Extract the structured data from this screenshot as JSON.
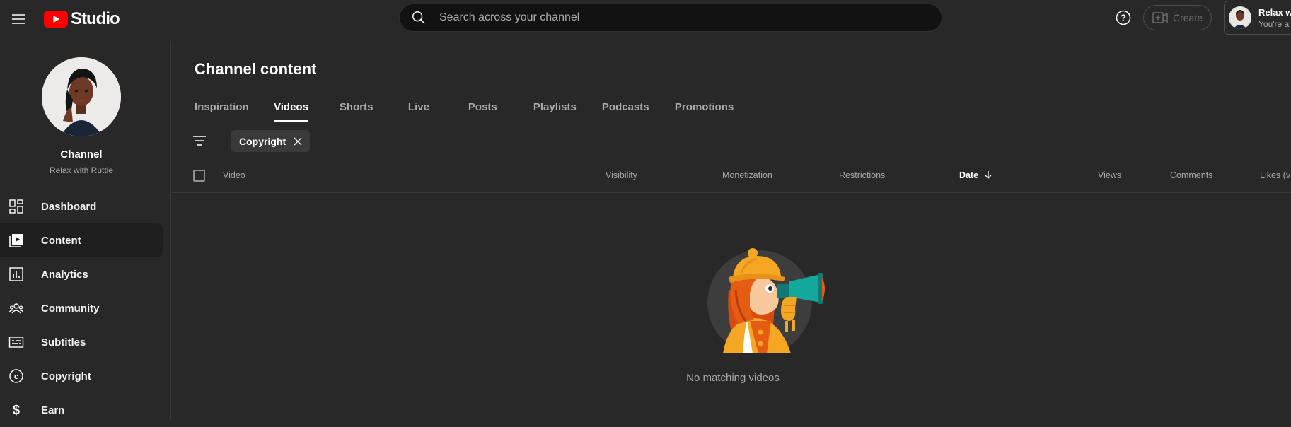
{
  "topbar": {
    "logo_text": "Studio",
    "search": {
      "placeholder": "Search across your channel",
      "value": ""
    },
    "create_label": "Create",
    "account": {
      "name": "Relax with Ruttie",
      "subtitle": "You're a"
    }
  },
  "sidebar": {
    "channel_label": "Channel",
    "channel_name": "Relax with Ruttie",
    "items": [
      {
        "label": "Dashboard",
        "icon": "dashboard-icon",
        "active": false
      },
      {
        "label": "Content",
        "icon": "content-icon",
        "active": true
      },
      {
        "label": "Analytics",
        "icon": "analytics-icon",
        "active": false
      },
      {
        "label": "Community",
        "icon": "community-icon",
        "active": false
      },
      {
        "label": "Subtitles",
        "icon": "subtitles-icon",
        "active": false
      },
      {
        "label": "Copyright",
        "icon": "copyright-icon",
        "active": false
      },
      {
        "label": "Earn",
        "icon": "earn-icon",
        "active": false
      }
    ]
  },
  "main": {
    "title": "Channel content",
    "tabs": [
      {
        "label": "Inspiration",
        "active": false
      },
      {
        "label": "Videos",
        "active": true
      },
      {
        "label": "Shorts",
        "active": false
      },
      {
        "label": "Live",
        "active": false
      },
      {
        "label": "Posts",
        "active": false
      },
      {
        "label": "Playlists",
        "active": false
      },
      {
        "label": "Podcasts",
        "active": false
      },
      {
        "label": "Promotions",
        "active": false
      }
    ],
    "filter_chip": "Copyright",
    "columns": {
      "video": "Video",
      "visibility": "Visibility",
      "monetization": "Monetization",
      "restrictions": "Restrictions",
      "date": "Date",
      "views": "Views",
      "comments": "Comments",
      "likes": "Likes (v"
    },
    "empty_message": "No matching videos"
  },
  "colors": {
    "background": "#282828",
    "youtube_red": "#ff0000",
    "text_secondary": "#aaaaaa",
    "divider": "#3a3a3a"
  }
}
